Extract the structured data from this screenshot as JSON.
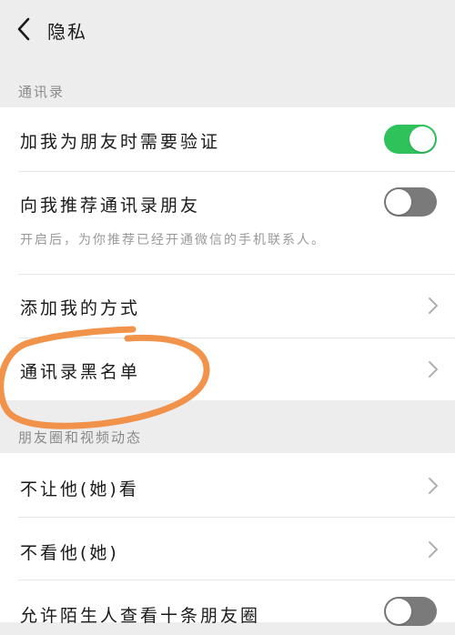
{
  "header": {
    "title": "隐私",
    "back_icon": "chevron-left-icon"
  },
  "sections": {
    "contacts_header": "通讯录",
    "moments_header": "朋友圈和视频动态"
  },
  "contacts": {
    "verify_label": "加我为朋友时需要验证",
    "verify_on": true,
    "recommend_label": "向我推荐通讯录朋友",
    "recommend_on": false,
    "recommend_sub": "开启后，为你推荐已经开通微信的手机联系人。",
    "add_methods_label": "添加我的方式",
    "blacklist_label": "通讯录黑名单"
  },
  "moments": {
    "block_view_label": "不让他(她)看",
    "hide_label": "不看他(她)",
    "stranger_label": "允许陌生人查看十条朋友圈",
    "stranger_on": false
  },
  "colors": {
    "toggle_on": "#2fc25b",
    "toggle_off": "#7a7a7a",
    "annotation": "#f08a3c",
    "background": "#ededed"
  }
}
